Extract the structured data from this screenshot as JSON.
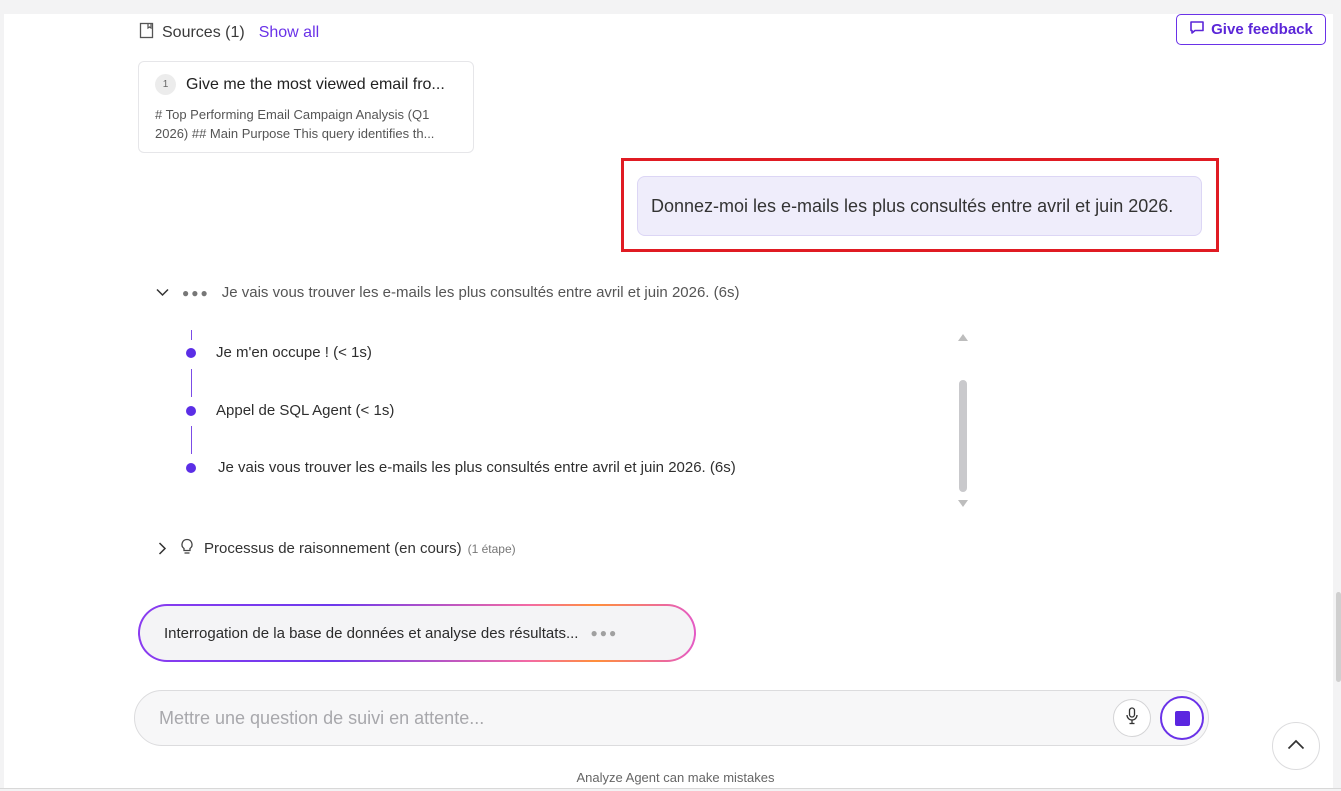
{
  "sources": {
    "label": "Sources (1)",
    "show_all": "Show all"
  },
  "feedback": {
    "label": "Give feedback"
  },
  "source_card": {
    "number": "1",
    "title": "Give me the most viewed email fro...",
    "description": "# Top Performing Email Campaign Analysis (Q1 2026) ## Main Purpose This query identifies th..."
  },
  "user_message": "Donnez-moi les e-mails les plus consultés entre avril et juin 2026.",
  "steps": {
    "header": "Je vais vous trouver les e-mails les plus consultés entre avril et juin 2026. (6s)",
    "items": [
      "Je m'en occupe ! (< 1s)",
      "Appel de SQL Agent (< 1s)",
      "Je vais vous trouver les e-mails les plus consultés entre avril et juin 2026. (6s)"
    ]
  },
  "reasoning": {
    "label": "Processus de raisonnement (en cours)",
    "detail": "(1 étape)"
  },
  "status_pill": "Interrogation de la base de données et analyse des résultats...",
  "input": {
    "placeholder": "Mettre une question de suivi en attente...",
    "value": ""
  },
  "disclaimer": "Analyze Agent can make mistakes",
  "colors": {
    "accent": "#6a32e8",
    "highlight": "#e01b23",
    "user_bubble": "#efedfb"
  },
  "icons": {
    "sources": "document-icon",
    "feedback": "chat-bubble-icon",
    "steps_toggle": "chevron-down-icon",
    "reasoning_toggle": "chevron-right-icon",
    "reasoning": "lightbulb-icon",
    "mic": "microphone-icon",
    "stop": "stop-icon",
    "scroll_top": "chevron-up-icon"
  }
}
